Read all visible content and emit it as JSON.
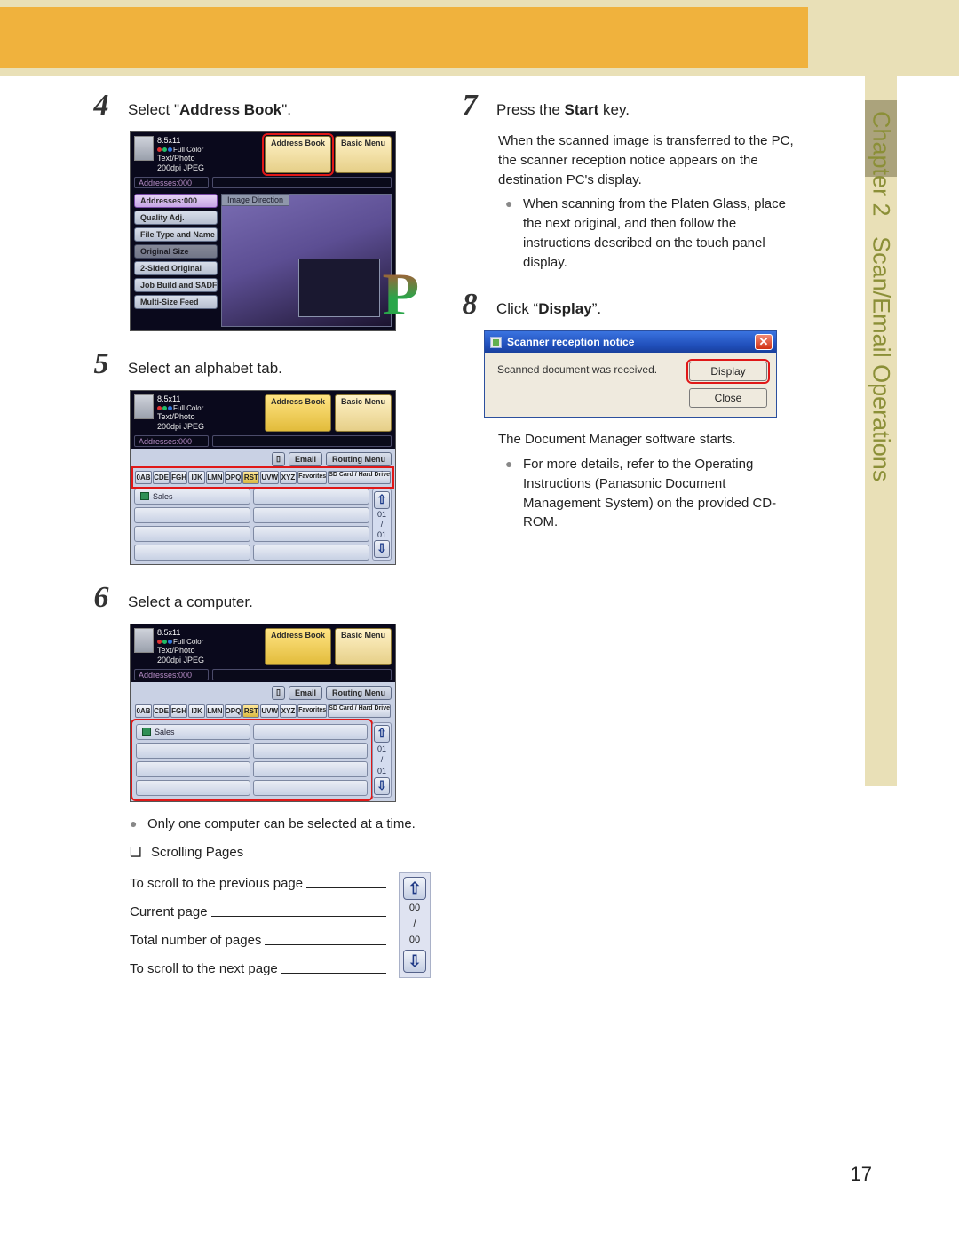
{
  "page_number": "17",
  "side": {
    "chapter": "Chapter 2",
    "title": "Scan/Email Operations"
  },
  "left": {
    "step4": {
      "num": "4",
      "text_pre": "Select \"",
      "bold": "Address Book",
      "text_post": "\"."
    },
    "step5": {
      "num": "5",
      "text": "Select an alphabet tab."
    },
    "step6": {
      "num": "6",
      "text": "Select a computer.",
      "bullet1": "Only one computer can be selected at a time.",
      "bullet2": "Scrolling Pages",
      "diag": {
        "l1": "To scroll to the previous page",
        "l2": "Current page",
        "l3": "Total number of pages",
        "l4": "To scroll to the next page",
        "v_cur": "00",
        "v_sep": "/",
        "v_tot": "00"
      }
    }
  },
  "right": {
    "step7": {
      "num": "7",
      "text_pre": "Press the ",
      "bold": "Start",
      "text_post": " key.",
      "body1": "When the scanned image is transferred to the PC, the scanner reception notice appears on the destination PC's display.",
      "bullet": "When scanning from the Platen Glass, place the next original, and then follow the instructions described on the touch panel display."
    },
    "step8": {
      "num": "8",
      "text_pre": "Click “",
      "bold": "Display",
      "text_post": "”.",
      "after1": "The Document Manager software starts.",
      "bullet": "For more details, refer to the Operating Instructions (Panasonic Document Management System) on the provided CD-ROM."
    }
  },
  "panel_common": {
    "size": "8.5x11",
    "fc": "Full Color",
    "mode": "Text/Photo",
    "res": "200dpi JPEG",
    "addr_book": "Address Book",
    "basic": "Basic Menu",
    "addresses": "Addresses:000",
    "email": "Email",
    "routing": "Routing Menu",
    "sdcard": "SD Card / Hard Drive",
    "fav": "Favorites",
    "image_dir": "Image Direction",
    "alpha": [
      "0AB",
      "CDE",
      "FGH",
      "IJK",
      "LMN",
      "OPQ",
      "RST",
      "UVW",
      "XYZ"
    ],
    "sales": "Sales",
    "scroll": {
      "cur": "01",
      "sep": "/",
      "tot": "01"
    },
    "side_buttons": [
      "Quality Adj.",
      "File Type and Name",
      "Original Size",
      "2-Sided Original",
      "Job Build and SADF",
      "Multi-Size Feed"
    ]
  },
  "dialog": {
    "title": "Scanner reception notice",
    "msg": "Scanned document was received.",
    "display": "Display",
    "close": "Close"
  }
}
